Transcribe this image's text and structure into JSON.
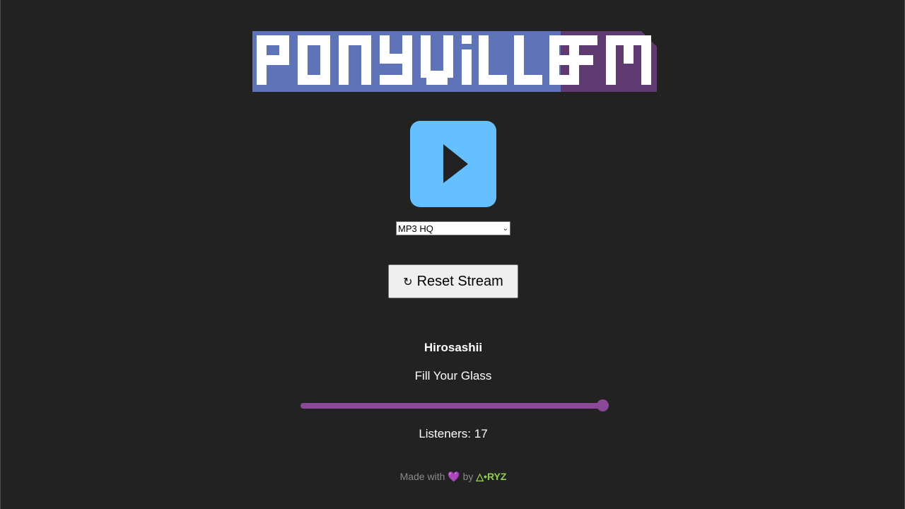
{
  "logo": {
    "text_main": "PONYVILLE",
    "text_accent": "FM",
    "color_main": "#5f73b9",
    "color_accent": "#5e3a70"
  },
  "player": {
    "play_icon": "play-icon",
    "play_color": "#66bfff",
    "quality_selected": "MP3 HQ",
    "reset_icon": "↻",
    "reset_label": "Reset Stream"
  },
  "now_playing": {
    "artist": "Hirosashii",
    "title": "Fill Your Glass"
  },
  "volume": {
    "level": 1.0,
    "color": "#8a4899"
  },
  "stats": {
    "listeners_text": "Listeners: 17"
  },
  "footer": {
    "made_with": "Made with",
    "heart": "💜",
    "by": "by",
    "brand": "△•RYZ",
    "brand_color": "#8fd14f"
  }
}
